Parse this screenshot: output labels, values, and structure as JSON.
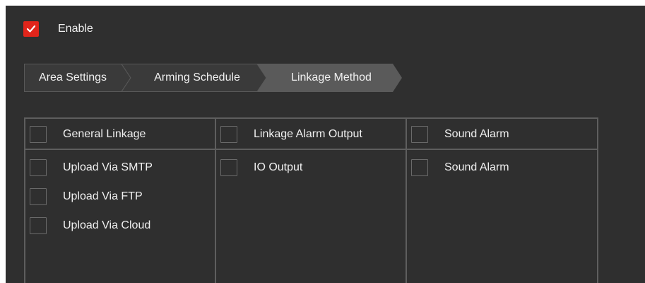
{
  "enable": {
    "label": "Enable",
    "checked": true
  },
  "tabs": [
    {
      "label": "Area Settings",
      "active": false
    },
    {
      "label": "Arming Schedule",
      "active": false
    },
    {
      "label": "Linkage Method",
      "active": true
    }
  ],
  "columns": [
    {
      "header": {
        "label": "General Linkage",
        "checked": false
      },
      "items": [
        {
          "label": "Upload Via SMTP",
          "checked": false
        },
        {
          "label": "Upload Via FTP",
          "checked": false
        },
        {
          "label": "Upload Via Cloud",
          "checked": false
        }
      ]
    },
    {
      "header": {
        "label": "Linkage Alarm Output",
        "checked": false
      },
      "items": [
        {
          "label": "IO Output",
          "checked": false
        }
      ]
    },
    {
      "header": {
        "label": "Sound Alarm",
        "checked": false
      },
      "items": [
        {
          "label": "Sound Alarm",
          "checked": false
        }
      ]
    }
  ],
  "colors": {
    "background": "#2f2f2f",
    "accent": "#e1251b",
    "tab_inactive": "#3a3a3a",
    "tab_active": "#5a5a5a",
    "border": "#5e5e5e"
  }
}
